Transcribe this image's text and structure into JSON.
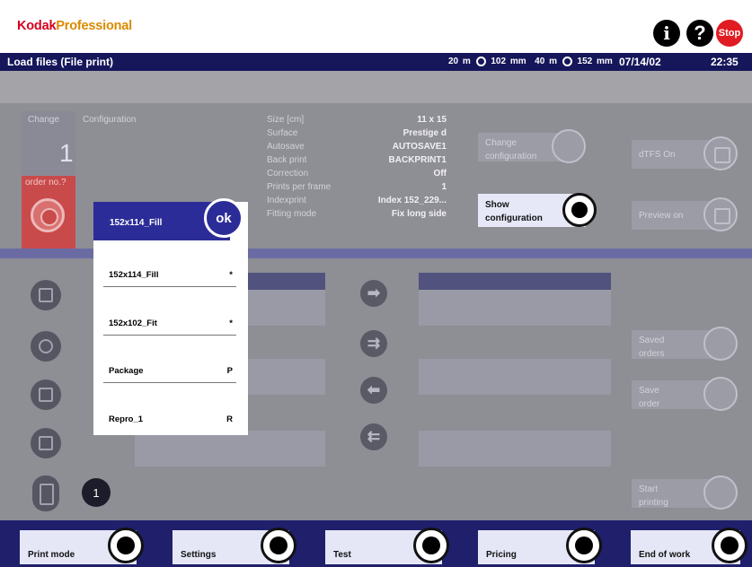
{
  "header": {
    "brand_kodak": "Kodak",
    "brand_professional": "Professional",
    "info_icon": "i",
    "help_icon": "?",
    "stop_label": "Stop"
  },
  "titlebar": {
    "title": "Load files (File print)",
    "film1": "20 m",
    "size1": "102 mm",
    "film2": "40 m",
    "size2": "152 mm",
    "date": "07/14/02",
    "time": "22:35"
  },
  "change": {
    "label": "Change",
    "count": "1",
    "order_label": "order no.?"
  },
  "configuration": {
    "heading": "Configuration",
    "rows": [
      {
        "label": "Size [cm]",
        "value": "11 x 15"
      },
      {
        "label": "Surface",
        "value": "Prestige d"
      },
      {
        "label": "Autosave",
        "value": "AUTOSAVE1"
      },
      {
        "label": "Back print",
        "value": "BACKPRINT1"
      },
      {
        "label": "Correction",
        "value": "Off"
      },
      {
        "label": "Prints per frame",
        "value": "1"
      },
      {
        "label": "Indexprint",
        "value": "Index 152_229..."
      },
      {
        "label": "Fitting mode",
        "value": "Fix long side"
      }
    ]
  },
  "right_buttons": {
    "change_configuration": {
      "line1": "Change",
      "line2": "configuration"
    },
    "show_configuration": {
      "line1": "Show",
      "line2": "configuration"
    },
    "dtfs": {
      "line1": "dTFS On"
    },
    "preview": {
      "line1": "Preview on"
    },
    "saved_orders": {
      "line1": "Saved",
      "line2": "orders"
    },
    "save_order": {
      "line1": "Save",
      "line2": "order"
    },
    "start_printing": {
      "line1": "Start",
      "line2": "printing"
    }
  },
  "counter_badge": "1",
  "popup": {
    "selected": "152x114_Fill",
    "ok_label": "ok",
    "items": [
      {
        "name": "152x114_Fill",
        "shortcut": "*"
      },
      {
        "name": "152x102_Fit",
        "shortcut": "*"
      },
      {
        "name": "Package",
        "shortcut": "P"
      },
      {
        "name": "Repro_1",
        "shortcut": "R"
      }
    ]
  },
  "arrows": {
    "a1": "➡",
    "a2": "⇉",
    "a3": "⬅",
    "a4": "⇇"
  },
  "bottom": {
    "print_mode": "Print mode",
    "settings": "Settings",
    "test": "Test",
    "pricing": "Pricing",
    "end_of_work": "End of work"
  },
  "colors": {
    "titlebar": "#16165a",
    "accent_blue": "#2c2c98",
    "order_red": "#c84a4a",
    "stop_red": "#e11b22"
  }
}
